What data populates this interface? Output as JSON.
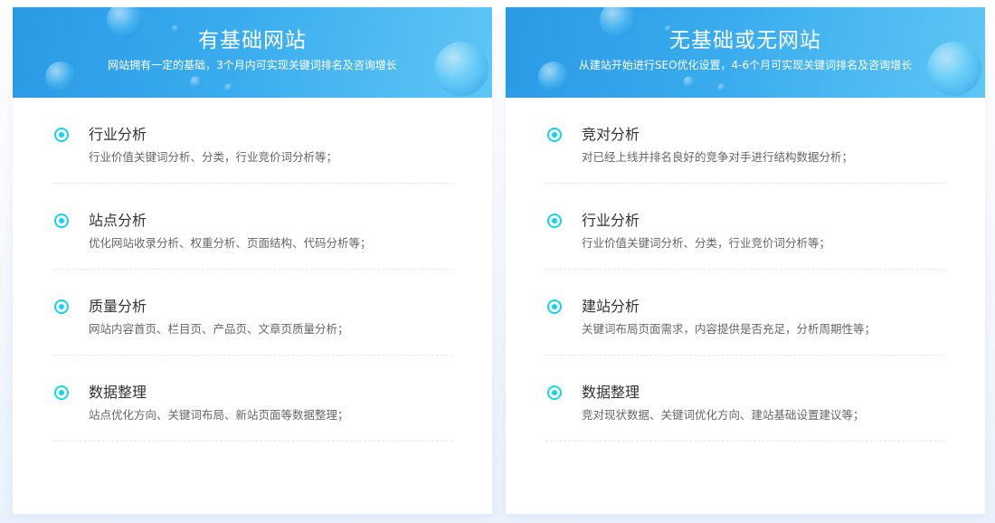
{
  "cards": [
    {
      "title": "有基础网站",
      "subtitle": "网站拥有一定的基础，3个月内可实现关键词排名及咨询增长",
      "items": [
        {
          "title": "行业分析",
          "desc": "行业价值关键词分析、分类，行业竞价词分析等；"
        },
        {
          "title": "站点分析",
          "desc": "优化网站收录分析、权重分析、页面结构、代码分析等；"
        },
        {
          "title": "质量分析",
          "desc": "网站内容首页、栏目页、产品页、文章页质量分析；"
        },
        {
          "title": "数据整理",
          "desc": "站点优化方向、关键词布局、新站页面等数据整理；"
        }
      ]
    },
    {
      "title": "无基础或无网站",
      "subtitle": "从建站开始进行SEO优化设置，4-6个月可实现关键词排名及咨询增长",
      "items": [
        {
          "title": "竞对分析",
          "desc": "对已经上线并排名良好的竞争对手进行结构数据分析；"
        },
        {
          "title": "行业分析",
          "desc": "行业价值关键词分析、分类，行业竞价词分析等；"
        },
        {
          "title": "建站分析",
          "desc": "关键词布局页面需求，内容提供是否充足，分析周期性等；"
        },
        {
          "title": "数据整理",
          "desc": "竞对现状数据、关键词优化方向、建站基础设置建议等；"
        }
      ]
    }
  ],
  "colors": {
    "header_gradient_start": "#2a9ae6",
    "header_gradient_end": "#5ec6f4",
    "bullet": "#14d3ee",
    "item_title": "#333333",
    "item_desc": "#666666"
  },
  "icons": {
    "bullet": "radio-circle-icon"
  }
}
